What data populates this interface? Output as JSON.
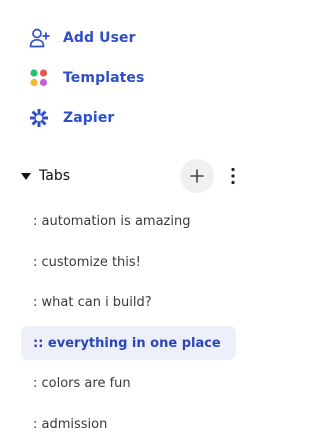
{
  "nav": {
    "items": [
      {
        "label": "Add User",
        "icon": "add-user-icon"
      },
      {
        "label": "Templates",
        "icon": "templates-icon"
      },
      {
        "label": "Zapier",
        "icon": "zapier-icon"
      }
    ]
  },
  "tabs": {
    "title": "Tabs",
    "add_icon": "plus-icon",
    "more_icon": "more-vertical-icon",
    "items": [
      {
        "label": ": automation is amazing",
        "active": false
      },
      {
        "label": ": customize this!",
        "active": false
      },
      {
        "label": ": what can i build?",
        "active": false
      },
      {
        "label": ":: everything in one place",
        "active": true
      },
      {
        "label": ": colors are fun",
        "active": false
      },
      {
        "label": ": admission",
        "active": false
      }
    ]
  },
  "colors": {
    "accent": "#2f4fc8",
    "active_background": "#edf0f9",
    "active_text": "#2b46b8",
    "text": "#3a3a3a"
  }
}
